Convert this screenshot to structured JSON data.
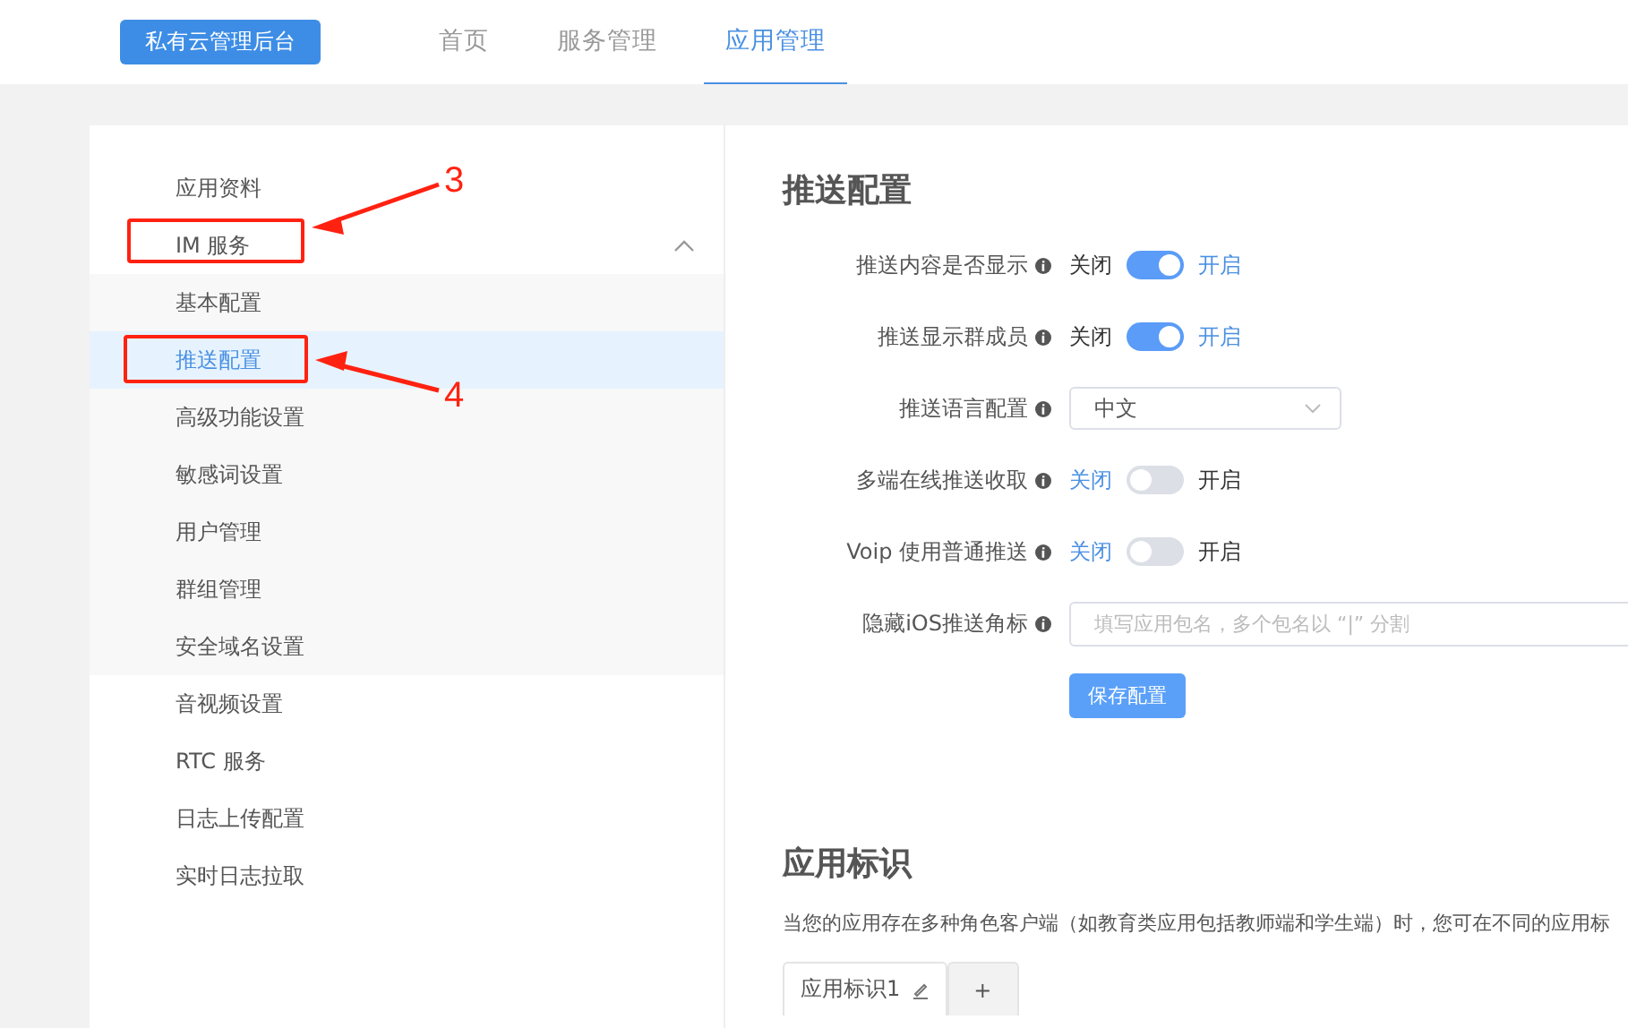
{
  "header": {
    "brand": "私有云管理后台",
    "nav": [
      {
        "label": "首页",
        "selected": false
      },
      {
        "label": "服务管理",
        "selected": false
      },
      {
        "label": "应用管理",
        "selected": true
      }
    ]
  },
  "sidebar": {
    "items": [
      {
        "label": "应用资料",
        "selected": false
      },
      {
        "label": "IM 服务",
        "selected": false,
        "expanded": true,
        "children": [
          {
            "label": "基本配置",
            "selected": false
          },
          {
            "label": "推送配置",
            "selected": true
          },
          {
            "label": "高级功能设置",
            "selected": false
          },
          {
            "label": "敏感词设置",
            "selected": false
          },
          {
            "label": "用户管理",
            "selected": false
          },
          {
            "label": "群组管理",
            "selected": false
          },
          {
            "label": "安全域名设置",
            "selected": false
          }
        ]
      },
      {
        "label": "音视频设置",
        "selected": false
      },
      {
        "label": "RTC 服务",
        "selected": false
      },
      {
        "label": "日志上传配置",
        "selected": false
      },
      {
        "label": "实时日志拉取",
        "selected": false
      }
    ]
  },
  "push_config": {
    "title": "推送配置",
    "fields": [
      {
        "kind": "toggle",
        "label": "推送内容是否显示",
        "off_label": "关闭",
        "on_label": "开启",
        "on": true
      },
      {
        "kind": "toggle",
        "label": "推送显示群成员",
        "off_label": "关闭",
        "on_label": "开启",
        "on": true
      },
      {
        "kind": "select",
        "label": "推送语言配置",
        "value": "中文"
      },
      {
        "kind": "toggle",
        "label": "多端在线推送收取",
        "off_label": "关闭",
        "on_label": "开启",
        "on": false
      },
      {
        "kind": "toggle",
        "label": "Voip 使用普通推送",
        "off_label": "关闭",
        "on_label": "开启",
        "on": false
      },
      {
        "kind": "text",
        "label": "隐藏iOS推送角标",
        "placeholder": "填写应用包名，多个包名以 “|” 分割"
      }
    ],
    "save_button": "保存配置"
  },
  "app_identity": {
    "title": "应用标识",
    "description": "当您的应用存在多种角色客户端（如教育类应用包括教师端和学生端）时，您可在不同的应用标",
    "tabs": [
      {
        "label": "应用标识1",
        "selected": true
      },
      {
        "label": "+",
        "selected": false
      }
    ]
  },
  "annotations": [
    {
      "label": "3"
    },
    {
      "label": "4"
    }
  ]
}
